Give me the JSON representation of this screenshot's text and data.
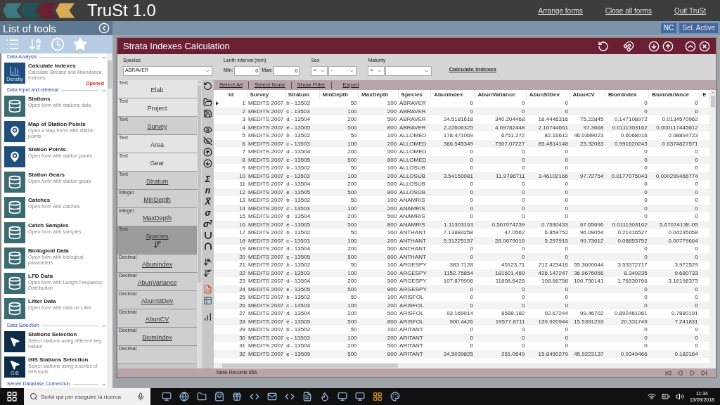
{
  "app": {
    "title": "TruSt 1.0",
    "links": [
      "Arrange forms",
      "Close all forms",
      "Quit TruSt"
    ],
    "badges": [
      "NC",
      "Sel. Active"
    ]
  },
  "sidebar": {
    "title": "List of tools",
    "sections": [
      {
        "title": "Data Analysis",
        "expanded": true,
        "items": [
          {
            "title": "Calculate Indexes",
            "description": "Calculate Bimass and Abundance Indexes",
            "kind": "density",
            "icon_caption": "Density",
            "status": "Opened"
          }
        ]
      },
      {
        "title": "Data Input and retrieval",
        "expanded": true,
        "items": [
          {
            "title": "Stations",
            "description": "Open form with stations data",
            "kind": "database"
          },
          {
            "title": "Map of Station Points",
            "description": "Open a Map Form with station points",
            "kind": "pin"
          },
          {
            "title": "Station Points",
            "description": "Open form with station points",
            "kind": "pin"
          },
          {
            "title": "Station Gears",
            "description": "Open form with station gears",
            "kind": "database"
          },
          {
            "title": "Catches",
            "description": "Open form with catches",
            "kind": "database"
          },
          {
            "title": "Catch Samples",
            "description": "Open form with samples",
            "kind": "database"
          },
          {
            "title": "Biological Data",
            "description": "Open form with biological parameters",
            "kind": "database"
          },
          {
            "title": "LFD Data",
            "description": "Open form with Lenght Frequency Distribution",
            "kind": "database"
          },
          {
            "title": "Litter Data",
            "description": "Open form with data on Litter",
            "kind": "database"
          }
        ]
      },
      {
        "title": "Data Selection",
        "expanded": true,
        "items": [
          {
            "title": "Stations Selection",
            "description": "Select stations using different key values",
            "kind": "cursor"
          },
          {
            "title": "GIS Stations Selection",
            "description": "Select stations using a series of GIS tools",
            "kind": "gis",
            "icon_caption": "GIS"
          }
        ]
      },
      {
        "title": "Server Database Connection",
        "expanded": true
      }
    ]
  },
  "form": {
    "title": "Strata Indexes Calculation",
    "filters": {
      "species": {
        "label": "Species",
        "value": "ABRAVER"
      },
      "length": {
        "label": "Lenth interval (mm)",
        "min_label": "Min:",
        "min": "0",
        "max_label": "Max:",
        "max": "0"
      },
      "sex": {
        "label": "Sex",
        "operator": "=",
        "value": "-"
      },
      "maturity": {
        "label": "Maturity",
        "operator": "="
      },
      "action": "Calculate Indexes"
    },
    "fields": [
      {
        "type": "Text",
        "label": "Elab",
        "in_table": false,
        "selected": false
      },
      {
        "type": "Text",
        "label": "Project",
        "in_table": false,
        "selected": false
      },
      {
        "type": "Text",
        "label": "Survey",
        "in_table": true,
        "selected": false
      },
      {
        "type": "Text",
        "label": "Area",
        "in_table": false,
        "selected": false
      },
      {
        "type": "Text",
        "label": "Gear",
        "in_table": false,
        "selected": false
      },
      {
        "type": "Text",
        "label": "Stratum",
        "in_table": true,
        "selected": false
      },
      {
        "type": "Integer",
        "label": "MinDepth",
        "in_table": true,
        "selected": false
      },
      {
        "type": "Integer",
        "label": "MaxDepth",
        "in_table": true,
        "selected": false
      },
      {
        "type": "Text",
        "label": "Species",
        "in_table": true,
        "selected": true
      },
      {
        "type": "Decimal",
        "label": "AbunIndex",
        "in_table": true,
        "selected": false
      },
      {
        "type": "Decimal",
        "label": "AbunVariance",
        "in_table": true,
        "selected": false
      },
      {
        "type": "Decimal",
        "label": "AbunStDev",
        "in_table": true,
        "selected": false
      },
      {
        "type": "Decimal",
        "label": "AbunCV",
        "in_table": true,
        "selected": false
      },
      {
        "type": "Decimal",
        "label": "BiomIndex",
        "in_table": true,
        "selected": false
      },
      {
        "type": "Decimal",
        "in_table": true,
        "selected": false
      }
    ],
    "stat_symbols": [
      "Σ",
      "n",
      "X̄",
      "σ",
      "σ$^{2}$"
    ],
    "table_actions": [
      "Select All",
      "Select None",
      "Show Filter",
      "Export"
    ],
    "table": {
      "columns": [
        "Id",
        "Survey",
        "Stratum",
        "MinDepth",
        "MaxDepth",
        "Species",
        "AbunIndex",
        "AbunVariance",
        "AbunStDev",
        "AbunCV",
        "BiomIndex",
        "BiomVariance",
        "E"
      ],
      "rows": [
        {
          "current": true,
          "cells": [
            "1",
            "MEDITS 2007",
            "b - 13502",
            "50",
            "100",
            "ABRAVER",
            "0",
            "0",
            "0",
            null,
            "0",
            "0"
          ]
        },
        {
          "current": false,
          "cells": [
            "2",
            "MEDITS 2007",
            "c - 13503",
            "100",
            "200",
            "ABRAVER",
            "0",
            "0",
            "0",
            null,
            "0",
            "0"
          ]
        },
        {
          "current": false,
          "cells": [
            "3",
            "MEDITS 2007",
            "d - 13504",
            "200",
            "500",
            "ABRAVER",
            "24.5181618",
            "340.204468",
            "18.4446316",
            "75.22845",
            "0.147108972",
            "0.0134570962"
          ]
        },
        {
          "current": false,
          "cells": [
            "4",
            "MEDITS 2007",
            "e - 13505",
            "500",
            "800",
            "ABRAVER",
            "2.22606325",
            "4.69782448",
            "2.16744661",
            "97.3668",
            "0.0111303162",
            "0.000117445612"
          ]
        },
        {
          "current": false,
          "cells": [
            "5",
            "MEDITS 2007",
            "b - 13502",
            "50",
            "100",
            "ALLOMED",
            "178.471069",
            "6751.272",
            "82.16612",
            "46.0389023",
            "0.6068016",
            "0.08894723"
          ]
        },
        {
          "current": false,
          "cells": [
            "6",
            "MEDITS 2007",
            "c - 13503",
            "100",
            "200",
            "ALLOMED",
            "366.545349",
            "7307.07227",
            "85.4814148",
            "23.32083",
            "0.991620243",
            "0.0374827571"
          ]
        },
        {
          "current": false,
          "cells": [
            "7",
            "MEDITS 2007",
            "d - 13504",
            "200",
            "500",
            "ALLOMED",
            "0",
            "0",
            "0",
            null,
            "0",
            "0"
          ]
        },
        {
          "current": false,
          "cells": [
            "8",
            "MEDITS 2007",
            "e - 13505",
            "500",
            "800",
            "ALLOMED",
            "0",
            "0",
            "0",
            null,
            "0",
            "0"
          ]
        },
        {
          "current": false,
          "cells": [
            "9",
            "MEDITS 2007",
            "b - 13502",
            "50",
            "100",
            "ALLOSUB",
            "0",
            "0",
            "0",
            null,
            "0",
            "0"
          ]
        },
        {
          "current": false,
          "cells": [
            "10",
            "MEDITS 2007",
            "c - 13503",
            "100",
            "200",
            "ALLOSUB",
            "3.54150081",
            "11.9786711",
            "3.46102166",
            "97.72754",
            "0.0177075043",
            "0.000299466774"
          ]
        },
        {
          "current": false,
          "cells": [
            "11",
            "MEDITS 2007",
            "d - 13504",
            "200",
            "500",
            "ALLOSUB",
            "0",
            "0",
            "0",
            null,
            "0",
            "0"
          ]
        },
        {
          "current": false,
          "cells": [
            "12",
            "MEDITS 2007",
            "e - 13505",
            "500",
            "800",
            "ALLOSUB",
            "0",
            "0",
            "0",
            null,
            "0",
            "0"
          ]
        },
        {
          "current": false,
          "cells": [
            "13",
            "MEDITS 2007",
            "b - 13502",
            "50",
            "100",
            "ANAMRIS",
            "0",
            "0",
            "0",
            null,
            "0",
            "0"
          ]
        },
        {
          "current": false,
          "cells": [
            "14",
            "MEDITS 2007",
            "c - 13503",
            "100",
            "200",
            "ANAMRIS",
            "0",
            "0",
            "0",
            null,
            "0",
            "0"
          ]
        },
        {
          "current": false,
          "cells": [
            "15",
            "MEDITS 2007",
            "d - 13504",
            "200",
            "500",
            "ANAMRIS",
            "0",
            "0",
            "0",
            null,
            "0",
            "0"
          ]
        },
        {
          "current": false,
          "cells": [
            "16",
            "MEDITS 2007",
            "e - 13505",
            "500",
            "800",
            "ANAMRIS",
            "1.11303163",
            "0.567074239",
            "0.7530433",
            "67.65696",
            "0.0111303162",
            "5.6707413E-05"
          ]
        },
        {
          "current": false,
          "cells": [
            "17",
            "MEDITS 2007",
            "b - 13502",
            "50",
            "100",
            "ANTHANT",
            "7.13884258",
            "47.0562",
            "6.859752",
            "96.09054",
            "0.21416527",
            "0.04235058"
          ]
        },
        {
          "current": false,
          "cells": [
            "18",
            "MEDITS 2007",
            "c - 13503",
            "100",
            "200",
            "ANTHANT",
            "5.31225157",
            "28.0679016",
            "5.297915",
            "99.73012",
            "0.08853752",
            "0.00779664"
          ]
        },
        {
          "current": false,
          "cells": [
            "19",
            "MEDITS 2007",
            "d - 13504",
            "200",
            "500",
            "ANTHANT",
            "0",
            "0",
            "0",
            null,
            "0",
            "0"
          ]
        },
        {
          "current": false,
          "cells": [
            "20",
            "MEDITS 2007",
            "e - 13505",
            "500",
            "800",
            "ANTHANT",
            "0",
            "0",
            "0",
            null,
            "0",
            "0"
          ]
        },
        {
          "current": false,
          "cells": [
            "21",
            "MEDITS 2007",
            "b - 13502",
            "50",
            "100",
            "ARGESPY",
            "383.7128",
            "45123.71",
            "212.423416",
            "55.3600044",
            "3.53372717",
            "3.972529"
          ]
        },
        {
          "current": false,
          "cells": [
            "22",
            "MEDITS 2007",
            "c - 13503",
            "100",
            "200",
            "ARGESPY",
            "1152.75854",
            "181601.469",
            "426.147247",
            "36.9676056",
            "8.340235",
            "9.680733"
          ]
        },
        {
          "current": false,
          "cells": [
            "23",
            "MEDITS 2007",
            "d - 13504",
            "200",
            "500",
            "ARGESPY",
            "107.879906",
            "11808.6426",
            "108.66758",
            "100.730141",
            "1.76530766",
            "3.16198373"
          ]
        },
        {
          "current": false,
          "cells": [
            "24",
            "MEDITS 2007",
            "e - 13505",
            "500",
            "800",
            "ARGESPY",
            "0",
            "0",
            "0",
            null,
            "0",
            "0"
          ]
        },
        {
          "current": false,
          "cells": [
            "25",
            "MEDITS 2007",
            "b - 13502",
            "50",
            "100",
            "ARISFOL",
            "0",
            "0",
            "0",
            null,
            "0",
            "0"
          ]
        },
        {
          "current": false,
          "cells": [
            "26",
            "MEDITS 2007",
            "c - 13503",
            "100",
            "200",
            "ARISFOL",
            "0",
            "0",
            "0",
            null,
            "0",
            "0"
          ]
        },
        {
          "current": false,
          "cells": [
            "27",
            "MEDITS 2007",
            "d - 13504",
            "200",
            "500",
            "ARISFOL",
            "93.169014",
            "8588.182",
            "92.67244",
            "99.46702",
            "0.892461061",
            "0.7880191"
          ]
        },
        {
          "current": false,
          "cells": [
            "28",
            "MEDITS 2007",
            "e - 13505",
            "500",
            "800",
            "ARISFOL",
            "900.4426",
            "19577.8711",
            "139.920944",
            "15.5391293",
            "20.331749",
            "7.241831"
          ]
        },
        {
          "current": false,
          "cells": [
            "29",
            "MEDITS 2007",
            "b - 13502",
            "50",
            "100",
            "ARITANT",
            "0",
            "0",
            "0",
            null,
            "0",
            "0"
          ]
        },
        {
          "current": false,
          "cells": [
            "30",
            "MEDITS 2007",
            "c - 13503",
            "100",
            "200",
            "ARITANT",
            "0",
            "0",
            "0",
            null,
            "0",
            "0"
          ]
        },
        {
          "current": false,
          "cells": [
            "31",
            "MEDITS 2007",
            "d - 13504",
            "200",
            "500",
            "ARITANT",
            "0",
            "0",
            "0",
            null,
            "0",
            "0"
          ]
        },
        {
          "current": false,
          "cells": [
            "32",
            "MEDITS 2007",
            "e - 13505",
            "500",
            "800",
            "ARITANT",
            "34.5039825",
            "251.0649",
            "15.8450279",
            "45.9223137",
            "0.9349466",
            "0.182164"
          ]
        }
      ]
    },
    "status": "Table Records 656"
  },
  "taskbar": {
    "search_placeholder": "Scrivi qui per eseguire la ricerca",
    "time": "11:34",
    "date": "13/09/2018"
  }
}
